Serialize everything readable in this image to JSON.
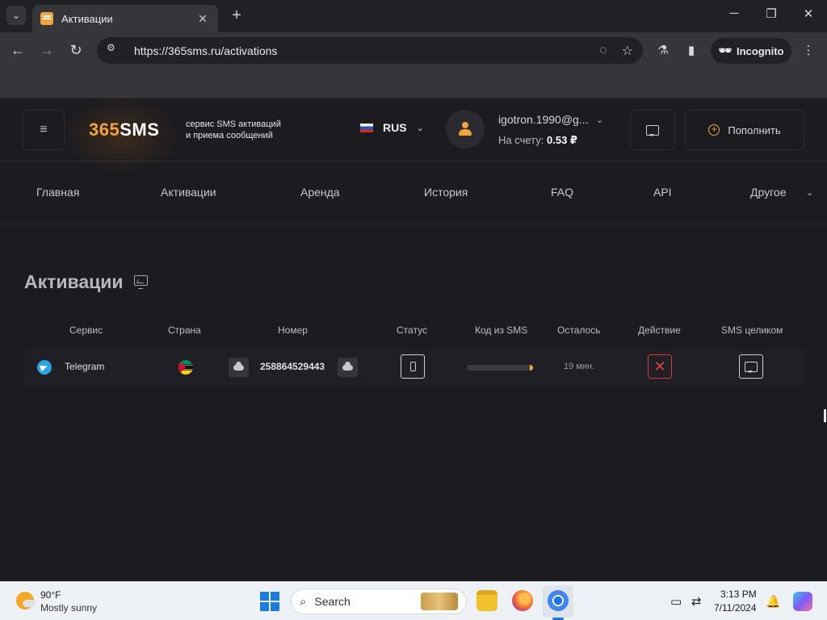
{
  "browser": {
    "tab_title": "Активации",
    "url": "https://365sms.ru/activations",
    "incognito_label": "Incognito",
    "new_tab": "+",
    "win_min": "─",
    "win_max": "❐",
    "win_close": "✕",
    "tab_close": "✕",
    "back": "←",
    "forward": "→",
    "reload": "↻",
    "tab_search": "⌄",
    "site_info": "⚙",
    "eye_off": "◌",
    "star": "☆",
    "labs": "⚗",
    "sidepanel": "▮",
    "menu": "⋮",
    "incognito_icon": "🕶"
  },
  "header": {
    "menu_icon": "≡",
    "logo_num": "365",
    "logo_text": "SMS",
    "tagline_1": "сервис SMS активаций",
    "tagline_2": "и приема сообщений",
    "language": "RUS",
    "caret": "⌄",
    "email": "igotron.1990@g...",
    "balance_label": "На счету:",
    "balance_value": "0.53 ₽",
    "topup_icon": "+",
    "topup_label": "Пополнить"
  },
  "nav": {
    "items": [
      "Главная",
      "Активации",
      "Аренда",
      "История",
      "FAQ",
      "API",
      "Другое"
    ]
  },
  "main": {
    "title": "Активации",
    "columns": [
      "Сервис",
      "Страна",
      "Номер",
      "Статус",
      "Код из SMS",
      "Осталось",
      "Действие",
      "SMS целиком"
    ],
    "rows": [
      {
        "service": "Telegram",
        "country_icon": "mozambique-flag",
        "number": "258864529443",
        "sms_progress": 0.05,
        "remaining": "19 мин.",
        "cancel_icon": "✕"
      }
    ]
  },
  "taskbar": {
    "temp": "90°F",
    "weather": "Mostly sunny",
    "search": "Search",
    "search_icon": "⌕",
    "time": "3:13 PM",
    "date": "7/11/2024",
    "bell": "🔔",
    "phone_link": "▭",
    "network": "⇄"
  },
  "colors": {
    "accent": "#f3a33b",
    "background": "#1b1b20",
    "danger": "#d33a3a"
  }
}
